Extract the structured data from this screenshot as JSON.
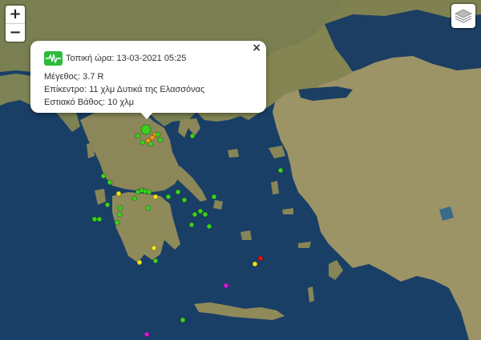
{
  "colors": {
    "sea": "#1a3f66",
    "land": "#8a8a5e",
    "marker_green": "#3bd11f",
    "marker_yellow": "#f3e21b",
    "marker_red": "#e01414",
    "marker_magenta": "#d21adb",
    "popup_icon": "#2dbb3c"
  },
  "controls": {
    "zoom_in": "+",
    "zoom_out": "−",
    "layers_icon": "layers-icon"
  },
  "popup": {
    "close": "×",
    "icon": "seismograph-icon",
    "time_label": "Τοπική ώρα:",
    "time_value": "13-03-2021 05:25",
    "magnitude_label": "Μέγεθος:",
    "magnitude_value": "3.7 R",
    "epicenter_label": "Επίκεντρο:",
    "epicenter_value": "11 χλμ Δυτικά της Ελασσόνας",
    "depth_label": "Εστιακό Βάθος:",
    "depth_value": "10 χλμ"
  }
}
